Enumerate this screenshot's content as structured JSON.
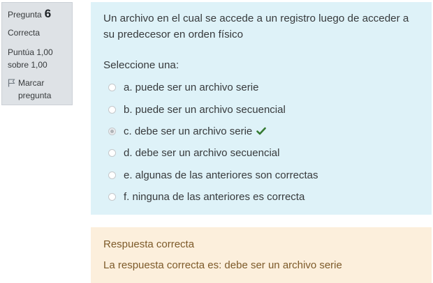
{
  "info": {
    "question_label": "Pregunta",
    "question_number": "6",
    "state": "Correcta",
    "grade_line1": "Puntúa 1,00",
    "grade_line2": "sobre 1,00",
    "flag_line1": "Marcar",
    "flag_line2": "pregunta"
  },
  "question": {
    "text": "Un archivo en el cual se accede a un registro luego de acceder a su predecesor en orden físico",
    "prompt": "Seleccione una:",
    "options": [
      {
        "label": "a. puede ser un archivo serie",
        "selected": false
      },
      {
        "label": "b. puede ser un archivo secuencial",
        "selected": false
      },
      {
        "label": "c. debe ser un archivo serie",
        "selected": true,
        "correct": true
      },
      {
        "label": "d. debe ser un archivo secuencial",
        "selected": false
      },
      {
        "label": "e. algunas de las anteriores son correctas",
        "selected": false
      },
      {
        "label": "f. ninguna de las anteriores es correcta",
        "selected": false
      }
    ]
  },
  "outcome": {
    "feedback": "Respuesta correcta",
    "right_answer": "La respuesta correcta es: debe ser un archivo serie"
  },
  "colors": {
    "info_bg": "#dee2e6",
    "question_bg": "#def2f8",
    "outcome_bg": "#fcefdc",
    "check_green": "#357a32"
  }
}
